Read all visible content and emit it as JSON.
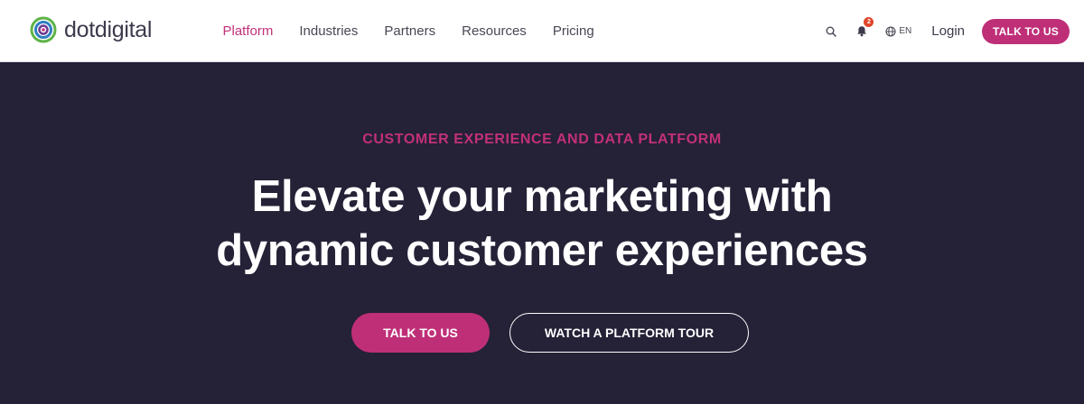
{
  "brand": {
    "name": "dotdigital",
    "colors": {
      "accent": "#bf2f78",
      "hero_bg": "#252137",
      "logo_green": "#5eb346",
      "logo_blue": "#2f7fc1",
      "logo_purple": "#6b3a93"
    }
  },
  "nav": {
    "items": [
      {
        "label": "Platform",
        "active": true
      },
      {
        "label": "Industries",
        "active": false
      },
      {
        "label": "Partners",
        "active": false
      },
      {
        "label": "Resources",
        "active": false
      },
      {
        "label": "Pricing",
        "active": false
      }
    ]
  },
  "utility": {
    "search_icon": "search-icon",
    "notifications_icon": "bell-icon",
    "notifications_count": "2",
    "language_icon": "globe-icon",
    "language_label": "EN",
    "login_label": "Login",
    "cta_label": "TALK TO US"
  },
  "hero": {
    "eyebrow": "CUSTOMER EXPERIENCE AND DATA PLATFORM",
    "headline_line1": "Elevate your marketing with",
    "headline_line2": "dynamic customer experiences",
    "primary_cta": "TALK TO US",
    "secondary_cta": "WATCH A PLATFORM TOUR"
  }
}
